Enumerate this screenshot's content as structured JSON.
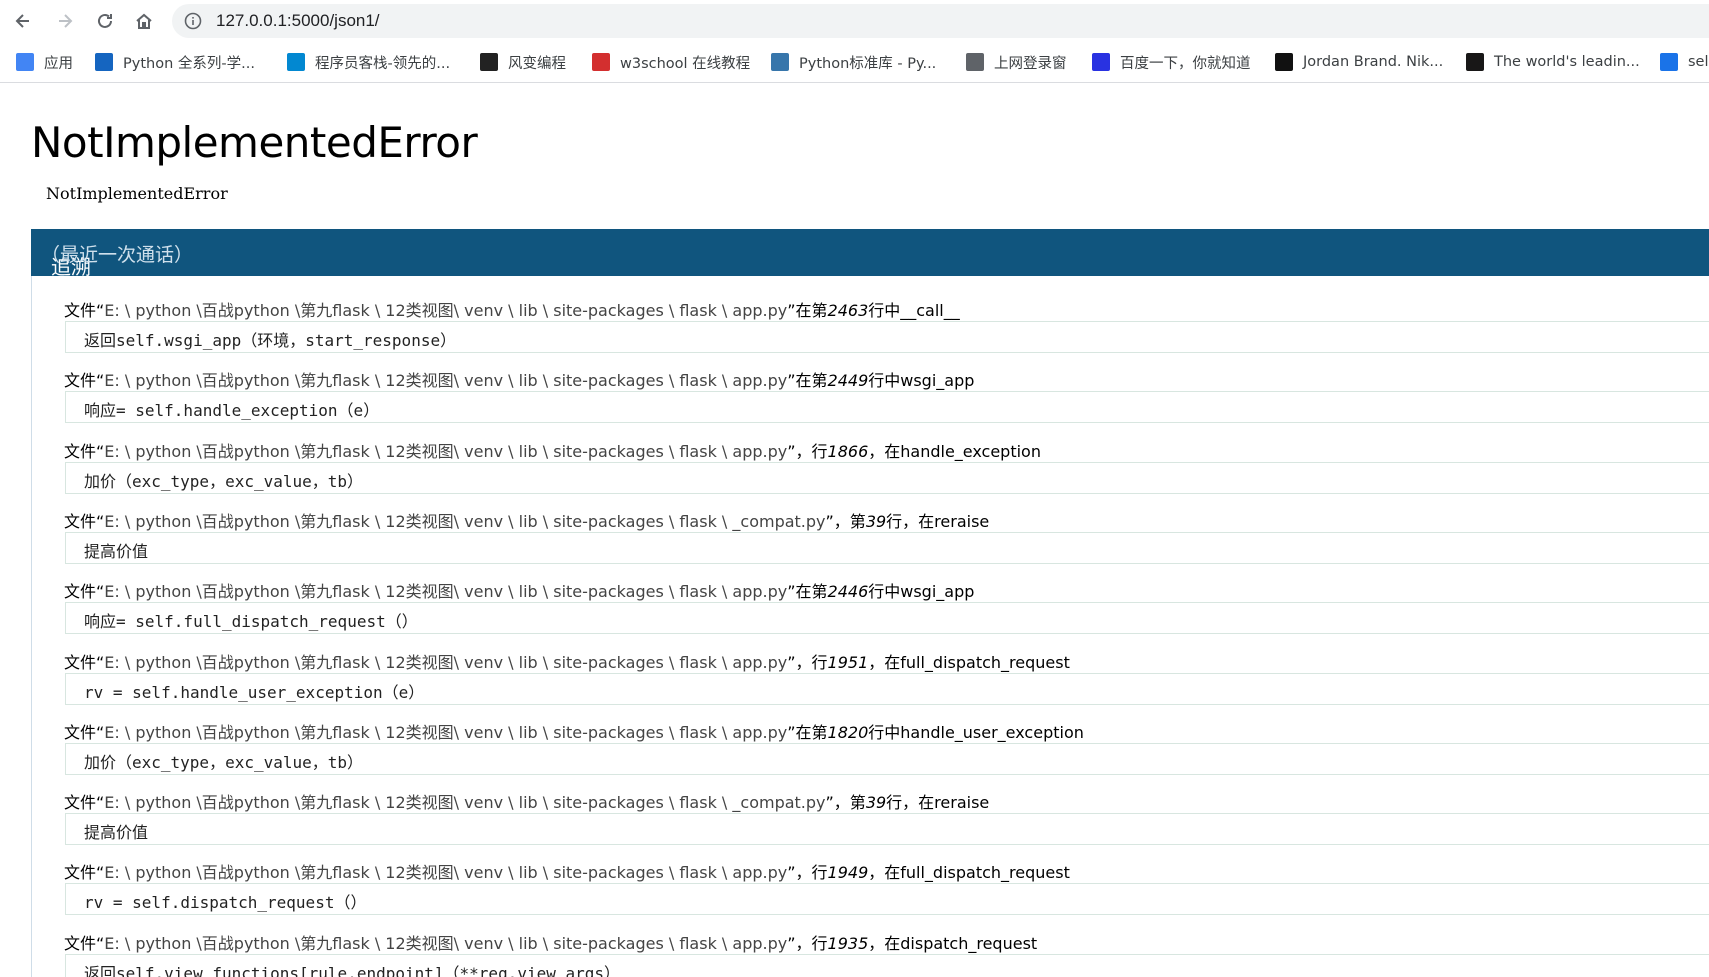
{
  "browser": {
    "url": "127.0.0.1:5000/json1/",
    "bookmarks": [
      {
        "label": "应用",
        "icon": "apps-grid-icon",
        "color": "#4285f4"
      },
      {
        "label": "Python 全系列-学...",
        "icon": "python-course-icon",
        "color": "#1565c0"
      },
      {
        "label": "程序员客栈-领先的...",
        "icon": "terminal-icon",
        "color": "#0288d1"
      },
      {
        "label": "风变编程",
        "icon": "panda-icon",
        "color": "#222222"
      },
      {
        "label": "w3school 在线教程",
        "icon": "w3school-icon",
        "color": "#d32f2f"
      },
      {
        "label": "Python标准库 - Py...",
        "icon": "python-logo-icon",
        "color": "#3776ab"
      },
      {
        "label": "上网登录窗",
        "icon": "globe-icon",
        "color": "#5f6368"
      },
      {
        "label": "百度一下，你就知道",
        "icon": "baidu-paw-icon",
        "color": "#2932e1"
      },
      {
        "label": "Jordan Brand. Nik...",
        "icon": "nike-icon",
        "color": "#111111"
      },
      {
        "label": "The world's leadin...",
        "icon": "github-icon",
        "color": "#181717"
      },
      {
        "label": "sel",
        "icon": "bookmark-icon",
        "color": "#1a73e8"
      }
    ]
  },
  "error": {
    "title": "NotImplementedError",
    "message": "NotImplementedError"
  },
  "traceback": {
    "header": "追溯",
    "header_sub": "（最近一次通话）",
    "frames": [
      {
        "prefix": "文件“",
        "path": "E: \\ python \\百战python \\第九flask \\ 12类视图\\ venv \\ lib \\ site-packages \\ flask \\ app.py",
        "mid": "”在第",
        "line": "2463",
        "suffix": "行中__call__",
        "code": "返回self.wsgi_app（环境，start_response）"
      },
      {
        "prefix": "文件“",
        "path": "E: \\ python \\百战python \\第九flask \\ 12类视图\\ venv \\ lib \\ site-packages \\ flask \\ app.py",
        "mid": "”在第",
        "line": "2449",
        "suffix": "行中wsgi_app",
        "code": "响应= self.handle_exception（e）"
      },
      {
        "prefix": "文件“",
        "path": "E: \\ python \\百战python \\第九flask \\ 12类视图\\ venv \\ lib \\ site-packages \\ flask \\ app.py",
        "mid": "”，行",
        "line": "1866",
        "suffix": "，在handle_exception",
        "code": "加价（exc_type，exc_value，tb）"
      },
      {
        "prefix": "文件“",
        "path": "E: \\ python \\百战python \\第九flask \\ 12类视图\\ venv \\ lib \\ site-packages \\ flask \\ _compat.py",
        "mid": "”，第",
        "line": "39",
        "suffix": "行，在reraise",
        "code": "提高价值"
      },
      {
        "prefix": "文件“",
        "path": "E: \\ python \\百战python \\第九flask \\ 12类视图\\ venv \\ lib \\ site-packages \\ flask \\ app.py",
        "mid": "”在第",
        "line": "2446",
        "suffix": "行中wsgi_app",
        "code": "响应= self.full_dispatch_request（）"
      },
      {
        "prefix": "文件“",
        "path": "E: \\ python \\百战python \\第九flask \\ 12类视图\\ venv \\ lib \\ site-packages \\ flask \\ app.py",
        "mid": "”，行",
        "line": "1951",
        "suffix": "，在full_dispatch_request",
        "code": "rv = self.handle_user_exception（e）"
      },
      {
        "prefix": "文件“",
        "path": "E: \\ python \\百战python \\第九flask \\ 12类视图\\ venv \\ lib \\ site-packages \\ flask \\ app.py",
        "mid": "”在第",
        "line": "1820",
        "suffix": "行中handle_user_exception",
        "code": "加价（exc_type，exc_value，tb）"
      },
      {
        "prefix": "文件“",
        "path": "E: \\ python \\百战python \\第九flask \\ 12类视图\\ venv \\ lib \\ site-packages \\ flask \\ _compat.py",
        "mid": "”，第",
        "line": "39",
        "suffix": "行，在reraise",
        "code": "提高价值"
      },
      {
        "prefix": "文件“",
        "path": "E: \\ python \\百战python \\第九flask \\ 12类视图\\ venv \\ lib \\ site-packages \\ flask \\ app.py",
        "mid": "”，行",
        "line": "1949",
        "suffix": "，在full_dispatch_request",
        "code": "rv = self.dispatch_request（）"
      },
      {
        "prefix": "文件“",
        "path": "E: \\ python \\百战python \\第九flask \\ 12类视图\\ venv \\ lib \\ site-packages \\ flask \\ app.py",
        "mid": "”，行",
        "line": "1935",
        "suffix": "，在dispatch_request",
        "code": "返回self.view_functions[rule.endpoint]（**req.view_args）"
      }
    ]
  },
  "colors": {
    "traceback_header": "#10557e",
    "code_border": "#d8e6e0"
  }
}
